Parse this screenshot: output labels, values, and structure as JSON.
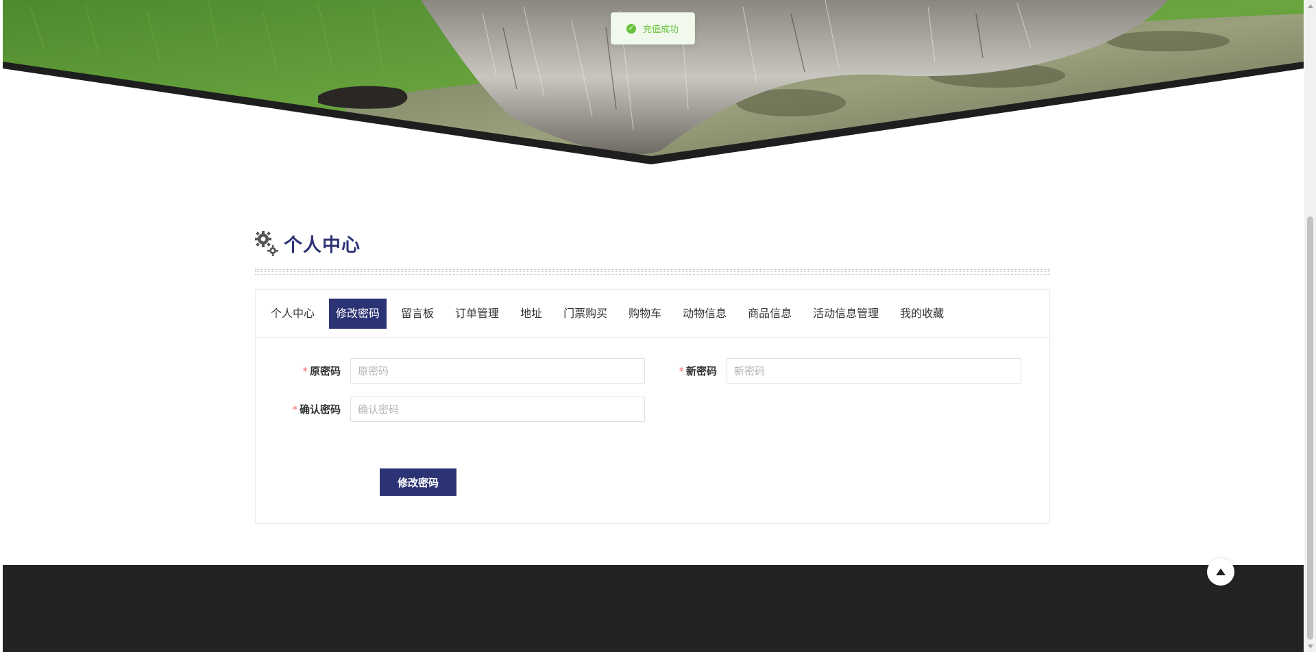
{
  "toast": {
    "message": "充值成功",
    "icon": "check-circle-icon",
    "color": "#67c23a"
  },
  "section": {
    "title": "个人中心",
    "icon": "gears-icon"
  },
  "tabs": [
    {
      "label": "个人中心",
      "active": false
    },
    {
      "label": "修改密码",
      "active": true
    },
    {
      "label": "留言板",
      "active": false
    },
    {
      "label": "订单管理",
      "active": false
    },
    {
      "label": "地址",
      "active": false
    },
    {
      "label": "门票购买",
      "active": false
    },
    {
      "label": "购物车",
      "active": false
    },
    {
      "label": "动物信息",
      "active": false
    },
    {
      "label": "商品信息",
      "active": false
    },
    {
      "label": "活动信息管理",
      "active": false
    },
    {
      "label": "我的收藏",
      "active": false
    }
  ],
  "form": {
    "old_password": {
      "label": "原密码",
      "placeholder": "原密码",
      "value": ""
    },
    "new_password": {
      "label": "新密码",
      "placeholder": "新密码",
      "value": ""
    },
    "confirm_password": {
      "label": "确认密码",
      "placeholder": "确认密码",
      "value": ""
    },
    "required_mark": "*",
    "submit_label": "修改密码"
  },
  "colors": {
    "primary": "#2c3374",
    "footer": "#232323",
    "required": "#f56c6c"
  },
  "back_to_top": {
    "icon": "arrow-up-icon"
  }
}
